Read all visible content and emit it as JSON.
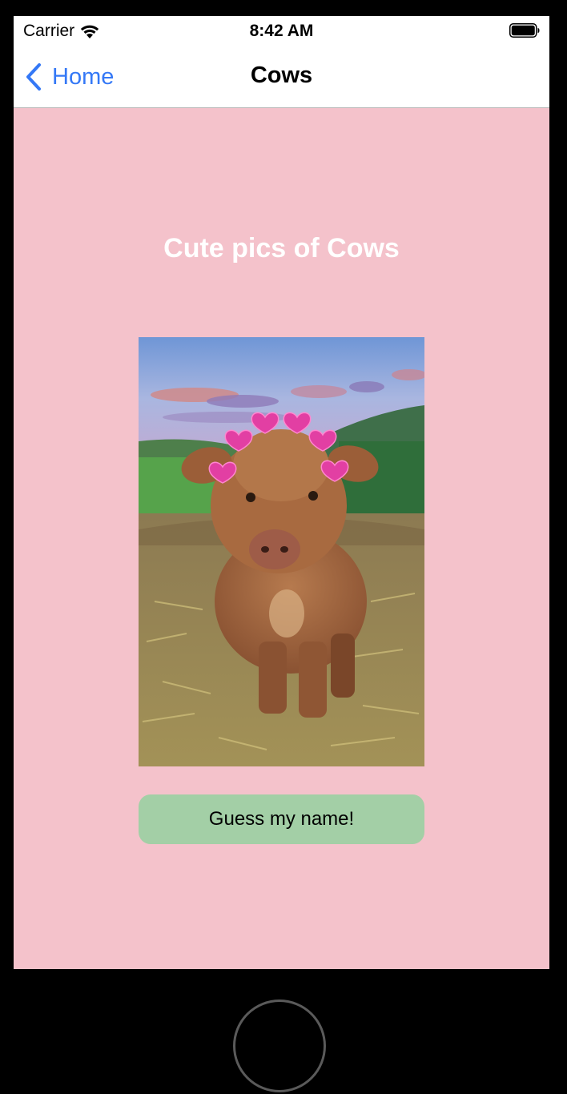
{
  "status_bar": {
    "carrier": "Carrier",
    "time": "8:42 AM"
  },
  "nav": {
    "back_label": "Home",
    "title": "Cows"
  },
  "content": {
    "heading": "Cute pics of Cows",
    "button_label": "Guess my name!"
  },
  "colors": {
    "background": "#f4c2cb",
    "accent": "#3478f6",
    "button": "#a3cfa6"
  }
}
